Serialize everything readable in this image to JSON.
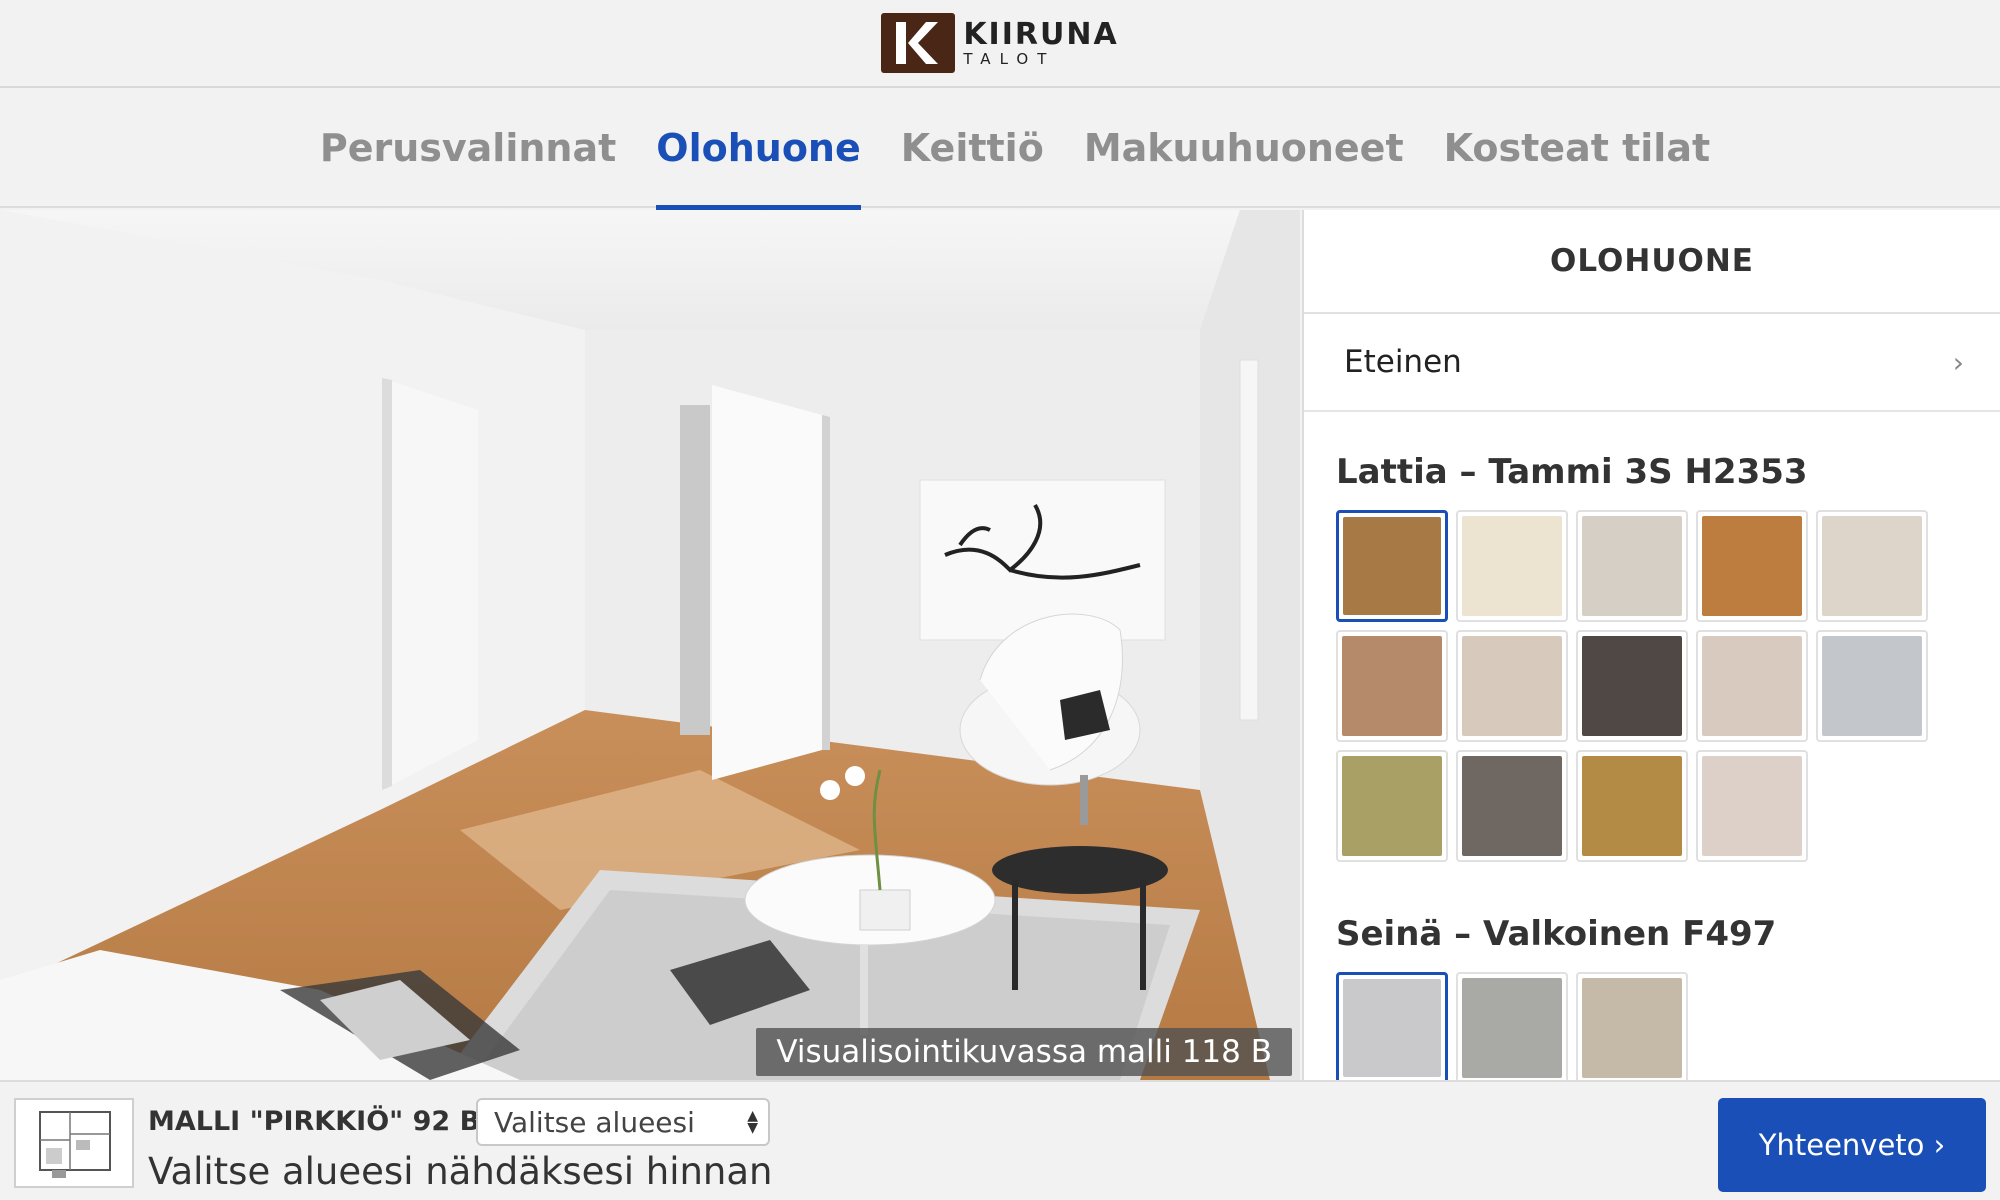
{
  "header": {
    "logo_name": "KIIRUNA",
    "logo_sub": "TALOT"
  },
  "tabs": [
    {
      "label": "Perusvalinnat",
      "active": false
    },
    {
      "label": "Olohuone",
      "active": true
    },
    {
      "label": "Keittiö",
      "active": false
    },
    {
      "label": "Makuuhuoneet",
      "active": false
    },
    {
      "label": "Kosteat tilat",
      "active": false
    }
  ],
  "room": {
    "caption": "Visualisointikuvassa malli 118 B"
  },
  "panel": {
    "title": "OLOHUONE",
    "subnav_label": "Eteinen",
    "floor": {
      "title": "Lattia – Tammi 3S H2353",
      "swatches": [
        "#a77a45",
        "#ece3d1",
        "#d6cfc6",
        "#bd7d3f",
        "#ddd5ca",
        "#b48a6a",
        "#d8c9bd",
        "#4f4845",
        "#d9cac0",
        "#c3c7cc",
        "#a8a065",
        "#6f6761",
        "#b48b45",
        "#ddd0c8"
      ]
    },
    "wall": {
      "title": "Seinä – Valkoinen F497",
      "swatches": [
        "#c9c9cb",
        "#a9a9a6",
        "#c5b9a8"
      ]
    }
  },
  "bottom": {
    "model_label": "MALLI \"PIRKKIÖ\" 92 B –",
    "select_value": "Valitse alueesi",
    "price_hint": "Valitse alueesi nähdäksesi hinnan",
    "summary_label": "Yhteenveto ›"
  },
  "colors": {
    "accent": "#1a4fb8",
    "logo_bg": "#4a2616",
    "tab_inactive": "#8f8f8f"
  }
}
